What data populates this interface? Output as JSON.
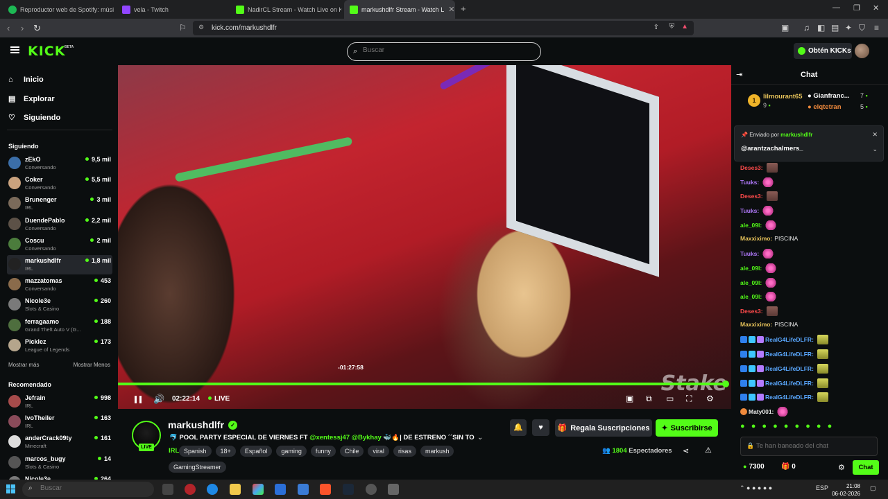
{
  "browser": {
    "tabs": [
      {
        "title": "Reproductor web de Spotify: música",
        "color": "#1db954"
      },
      {
        "title": "vela - Twitch",
        "color": "#9146ff"
      },
      {
        "title": "NadirCL Stream - Watch Live on K",
        "color": "#53fc18"
      },
      {
        "title": "markushdlfr Stream - Watch L",
        "color": "#53fc18"
      }
    ],
    "new_tab_icon": "+",
    "url": "kick.com/markushdlfr"
  },
  "header": {
    "logo": "KICK",
    "beta": "BETA",
    "search_placeholder": "Buscar",
    "get_kicks": "Obtén KICKs"
  },
  "sidebar": {
    "nav": [
      {
        "label": "Inicio",
        "icon": "home-icon"
      },
      {
        "label": "Explorar",
        "icon": "explore-icon"
      },
      {
        "label": "Siguiendo",
        "icon": "heart-icon"
      }
    ],
    "following_header": "Siguiendo",
    "following": [
      {
        "name": "zEkO",
        "category": "Conversando",
        "viewers": "9,5 mil",
        "color": "#3b6ea8"
      },
      {
        "name": "Coker",
        "category": "Conversando",
        "viewers": "5,5 mil",
        "color": "#c9a27e"
      },
      {
        "name": "Brunenger",
        "category": "IRL",
        "viewers": "3 mil",
        "color": "#7a6a5a"
      },
      {
        "name": "DuendePablo",
        "category": "Conversando",
        "viewers": "2,2 mil",
        "color": "#5c5147"
      },
      {
        "name": "Coscu",
        "category": "Conversando",
        "viewers": "2 mil",
        "color": "#4b7c3c"
      },
      {
        "name": "markushdlfr",
        "category": "IRL",
        "viewers": "1,8 mil",
        "color": "#222"
      },
      {
        "name": "mazzatomas",
        "category": "Conversando",
        "viewers": "453",
        "color": "#8a6b4b"
      },
      {
        "name": "Nicole3e",
        "category": "Slots & Casino",
        "viewers": "260",
        "color": "#7a7a7a"
      },
      {
        "name": "ferragaamo",
        "category": "Grand Theft Auto V (G...",
        "viewers": "188",
        "color": "#4e6e3e"
      },
      {
        "name": "Picklez",
        "category": "League of Legends",
        "viewers": "173",
        "color": "#b5a58c"
      }
    ],
    "show_more": "Mostrar más",
    "show_less": "Mostrar Menos",
    "recommended_header": "Recomendado",
    "recommended": [
      {
        "name": "Jefrain",
        "category": "IRL",
        "viewers": "998",
        "color": "#a64b4b"
      },
      {
        "name": "IvoTheiler",
        "category": "IRL",
        "viewers": "163",
        "color": "#8a4b5a"
      },
      {
        "name": "anderCrack09ty",
        "category": "Minecraft",
        "viewers": "161",
        "color": "#ddd"
      },
      {
        "name": "marcos_bugy",
        "category": "Slots & Casino",
        "viewers": "14",
        "color": "#555"
      },
      {
        "name": "Nicole3e",
        "category": "",
        "viewers": "264",
        "color": "#7a7a7a"
      }
    ]
  },
  "player": {
    "hover_time": "-01:27:58",
    "elapsed": "02:22:14",
    "live": "LIVE",
    "progress": 0.995,
    "watermark": "Stake"
  },
  "stream": {
    "name": "markushdlfr",
    "live_badge": "LIVE",
    "title_prefix": "🐬 POOL PARTY ESPECIAL DE VIERNES FT ",
    "mention1": "@xentessj47",
    "mention2": "@Bykhay",
    "title_suffix": " 🐳🔥| DE ESTRENO ´´SIN TO...",
    "category": "IRL",
    "tags": [
      "Spanish",
      "18+",
      "Español",
      "gaming",
      "funny",
      "Chile",
      "viral",
      "risas",
      "markush"
    ],
    "tag_row2": "GamingStreamer",
    "gift_label": "Regala Suscripciones",
    "subscribe_label": "Suscribirse",
    "viewers": "1804",
    "viewers_label": "Espectadores"
  },
  "chat": {
    "title": "Chat",
    "leaderboard": [
      {
        "rank": "1",
        "name": "lilmourant65",
        "count": "9"
      },
      {
        "name": "Gianfranc...",
        "count": "7",
        "color": "#ffffff"
      },
      {
        "name": "elqtetran",
        "count": "5",
        "color": "#f08a3c"
      }
    ],
    "pinned_by_label": "Enviado por",
    "pinned_by": "markushdlfr",
    "pinned_msg": "@arantzachalmers_",
    "messages": [
      {
        "user": "Deses3:",
        "text": "",
        "color": "#ff4b4b",
        "emote": "face"
      },
      {
        "user": "Tuuks:",
        "text": "",
        "color": "#b37bff",
        "emote": "pink"
      },
      {
        "user": "Deses3:",
        "text": "",
        "color": "#ff4b4b",
        "emote": "face"
      },
      {
        "user": "Tuuks:",
        "text": "",
        "color": "#b37bff",
        "emote": "pink"
      },
      {
        "user": "ale_09l:",
        "text": "",
        "color": "#53fc18",
        "emote": "pink"
      },
      {
        "user": "Maxxiximo:",
        "text": "PISCINA",
        "color": "#e6c25a",
        "emote": ""
      },
      {
        "user": "Tuuks:",
        "text": "",
        "color": "#b37bff",
        "emote": "pink"
      },
      {
        "user": "ale_09l:",
        "text": "",
        "color": "#53fc18",
        "emote": "pink"
      },
      {
        "user": "ale_09l:",
        "text": "",
        "color": "#53fc18",
        "emote": "pink"
      },
      {
        "user": "ale_09l:",
        "text": "",
        "color": "#53fc18",
        "emote": "pink"
      },
      {
        "user": "Deses3:",
        "text": "",
        "color": "#ff4b4b",
        "emote": "face"
      },
      {
        "user": "Maxxiximo:",
        "text": "PISCINA",
        "color": "#e6c25a",
        "emote": ""
      },
      {
        "user": "RealG4LifeDLFR:",
        "text": "",
        "color": "#5aa8ff",
        "emote": "yell"
      },
      {
        "user": "RealG4LifeDLFR:",
        "text": "",
        "color": "#5aa8ff",
        "emote": "yell"
      },
      {
        "user": "RealG4LifeDLFR:",
        "text": "",
        "color": "#5aa8ff",
        "emote": "yell"
      },
      {
        "user": "RealG4LifeDLFR:",
        "text": "",
        "color": "#5aa8ff",
        "emote": "yell"
      },
      {
        "user": "RealG4LifeDLFR:",
        "text": "",
        "color": "#5aa8ff",
        "emote": "yell"
      },
      {
        "user": "Maty001:",
        "text": "",
        "color": "#e8e8e8",
        "emote": "pink"
      }
    ],
    "input_placeholder": "Te han baneado del chat",
    "points": "7300",
    "gifts": "0",
    "send_label": "Chat"
  },
  "taskbar": {
    "search_placeholder": "Buscar",
    "lang": "ESP",
    "time": "21:08",
    "date": "06-02-2026"
  }
}
